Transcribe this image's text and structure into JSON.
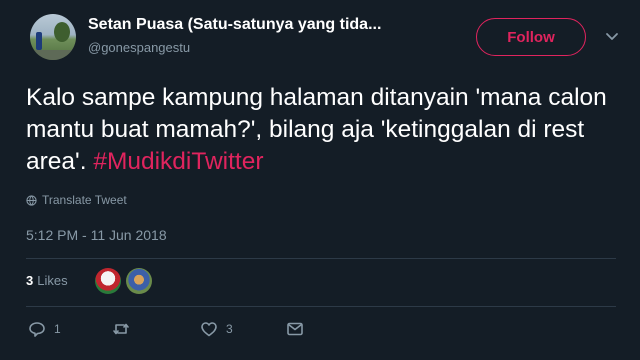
{
  "user": {
    "display_name": "Setan Puasa (Satu-satunya yang tida...",
    "handle": "@gonespangestu"
  },
  "follow_label": "Follow",
  "tweet": {
    "text": "Kalo sampe kampung halaman ditanyain 'mana calon mantu buat mamah?', bilang aja 'ketinggalan di rest area'. ",
    "hashtag": "#MudikdiTwitter"
  },
  "translate_label": "Translate Tweet",
  "timestamp": "5:12 PM - 11 Jun 2018",
  "likes": {
    "count": "3",
    "label": "Likes"
  },
  "actions": {
    "reply_count": "1",
    "like_count": "3"
  },
  "colors": {
    "background": "#141d26",
    "accent": "#e0245e",
    "muted": "#8899a6"
  },
  "icons": [
    "avatar",
    "caret-down-icon",
    "globe-icon",
    "reply-icon",
    "retweet-icon",
    "like-icon",
    "message-icon"
  ]
}
